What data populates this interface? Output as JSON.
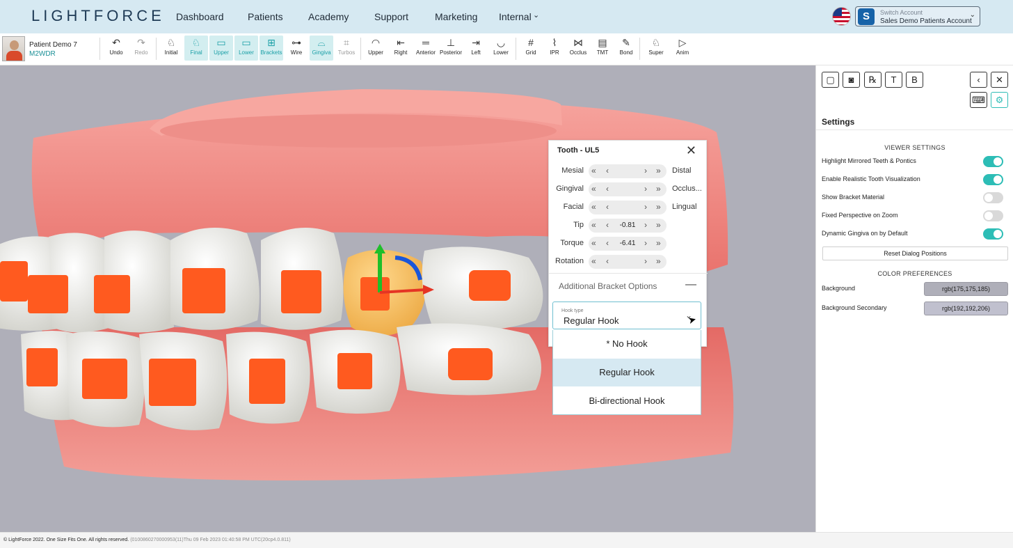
{
  "app": {
    "logo": "LIGHTFORCE"
  },
  "nav": {
    "items": [
      {
        "label": "Dashboard"
      },
      {
        "label": "Patients"
      },
      {
        "label": "Academy"
      },
      {
        "label": "Support"
      },
      {
        "label": "Marketing"
      },
      {
        "label": "Internal"
      }
    ],
    "internal_caret_icon": "chevron-down-icon"
  },
  "account": {
    "flag_icon": "us-flag-icon",
    "avatar_letter": "S",
    "title": "Switch Account",
    "name": "Sales Demo Patients Account",
    "avatar_color": "#1763a8"
  },
  "patient": {
    "name": "Patient Demo 7",
    "id": "M2WDR"
  },
  "toolbar": {
    "tools": [
      {
        "label": "Undo",
        "icon": "undo-icon",
        "glyph": "↶",
        "state": "normal"
      },
      {
        "label": "Redo",
        "icon": "redo-icon",
        "glyph": "↷",
        "state": "disabled"
      },
      {
        "label": "Initial",
        "icon": "tooth-initial-icon",
        "glyph": "♘",
        "state": "normal"
      },
      {
        "label": "Final",
        "icon": "tooth-final-icon",
        "glyph": "♘",
        "state": "active"
      },
      {
        "label": "Upper",
        "icon": "upper-arch-icon",
        "glyph": "▭",
        "state": "active"
      },
      {
        "label": "Lower",
        "icon": "lower-arch-icon",
        "glyph": "▭",
        "state": "active"
      },
      {
        "label": "Brackets",
        "icon": "brackets-icon",
        "glyph": "⊞",
        "state": "active"
      },
      {
        "label": "Wire",
        "icon": "wire-icon",
        "glyph": "⊶",
        "state": "normal"
      },
      {
        "label": "Gingiva",
        "icon": "gingiva-icon",
        "glyph": "⌓",
        "state": "active"
      },
      {
        "label": "Turbos",
        "icon": "turbos-icon",
        "glyph": "⌗",
        "state": "disabled"
      },
      {
        "label": "Upper",
        "icon": "view-upper-icon",
        "glyph": "◠",
        "state": "normal"
      },
      {
        "label": "Right",
        "icon": "view-right-icon",
        "glyph": "⇤",
        "state": "normal"
      },
      {
        "label": "Anterior",
        "icon": "view-anterior-icon",
        "glyph": "═",
        "state": "normal"
      },
      {
        "label": "Posterior",
        "icon": "view-posterior-icon",
        "glyph": "⊥",
        "state": "normal"
      },
      {
        "label": "Left",
        "icon": "view-left-icon",
        "glyph": "⇥",
        "state": "normal"
      },
      {
        "label": "Lower",
        "icon": "view-lower-icon",
        "glyph": "◡",
        "state": "normal"
      },
      {
        "label": "Grid",
        "icon": "grid-icon",
        "glyph": "#",
        "state": "normal"
      },
      {
        "label": "IPR",
        "icon": "ipr-icon",
        "glyph": "⌇",
        "state": "normal"
      },
      {
        "label": "Occlus",
        "icon": "occlusion-icon",
        "glyph": "⋈",
        "state": "normal"
      },
      {
        "label": "TMT",
        "icon": "tmt-table-icon",
        "glyph": "▤",
        "state": "normal"
      },
      {
        "label": "Bond",
        "icon": "bond-icon",
        "glyph": "✎",
        "state": "normal"
      },
      {
        "label": "Super",
        "icon": "superimpose-icon",
        "glyph": "♘",
        "state": "normal"
      },
      {
        "label": "Anim",
        "icon": "animation-play-icon",
        "glyph": "▷",
        "state": "normal"
      }
    ]
  },
  "viewport": {
    "background": "#afafb9",
    "gum_color": "#f08a84",
    "bracket_color": "#ff5a1f",
    "selected_tooth_color": "#f4b860"
  },
  "tooth_dialog": {
    "title": "Tooth - UL5",
    "rows": [
      {
        "label": "Mesial",
        "value": "",
        "right": "Distal"
      },
      {
        "label": "Gingival",
        "value": "",
        "right": "Occlus..."
      },
      {
        "label": "Facial",
        "value": "",
        "right": "Lingual"
      },
      {
        "label": "Tip",
        "value": "-0.81",
        "right": ""
      },
      {
        "label": "Torque",
        "value": "-6.41",
        "right": ""
      },
      {
        "label": "Rotation",
        "value": "",
        "right": ""
      }
    ],
    "bracket_options_label": "Additional Bracket Options",
    "hook_select": {
      "caption": "Hook type",
      "value": "Regular Hook",
      "options": [
        "* No Hook",
        "Regular Hook",
        "Bi-directional Hook"
      ]
    }
  },
  "panel": {
    "buttons_left": [
      {
        "icon": "comment-icon",
        "glyph": "▢"
      },
      {
        "icon": "camera-icon",
        "glyph": "◙"
      },
      {
        "icon": "prescription-icon",
        "glyph": "℞"
      },
      {
        "icon": "clear-format-icon",
        "glyph": "T"
      },
      {
        "icon": "bold-icon",
        "glyph": "B"
      }
    ],
    "buttons_right": [
      {
        "icon": "collapse-left-icon",
        "glyph": "‹"
      },
      {
        "icon": "close-icon",
        "glyph": "✕"
      },
      {
        "icon": "keyboard-icon",
        "glyph": "⌨"
      },
      {
        "icon": "settings-gear-icon",
        "glyph": "⚙"
      }
    ],
    "settings_title": "Settings",
    "viewer_settings_heading": "VIEWER SETTINGS",
    "toggles": [
      {
        "label": "Highlight Mirrored Teeth & Pontics",
        "on": true
      },
      {
        "label": "Enable Realistic Tooth Visualization",
        "on": true
      },
      {
        "label": "Show Bracket Material",
        "on": false
      },
      {
        "label": "Fixed Perspective on Zoom",
        "on": false
      },
      {
        "label": "Dynamic Gingiva on by Default",
        "on": true
      }
    ],
    "reset_label": "Reset Dialog Positions",
    "color_heading": "COLOR PREFERENCES",
    "colors": [
      {
        "label": "Background",
        "value": "rgb(175,175,185)",
        "swatch": "#afafb9"
      },
      {
        "label": "Background Secondary",
        "value": "rgb(192,192,206)",
        "swatch": "#c0c0ce"
      }
    ],
    "accent": "#2dbdb6"
  },
  "footer": {
    "copyright": "© LightForce 2022. One Size Fits One. All rights reserved.",
    "build": "(0100860270000953(11)Thu 09 Feb 2023 01:40:58 PM UTC(20cp4.0.811)"
  }
}
